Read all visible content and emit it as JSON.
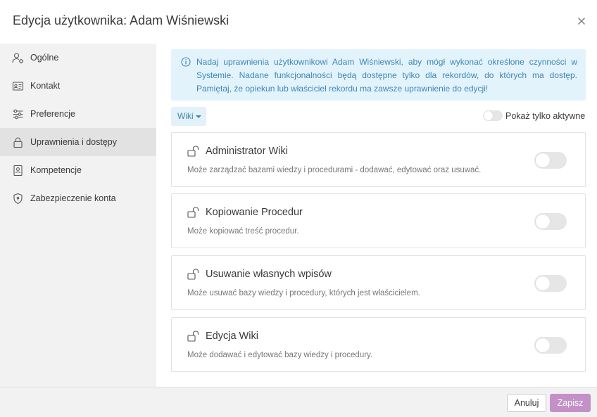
{
  "header": {
    "title": "Edycja użytkownika: Adam Wiśniewski",
    "close_icon": "close-icon"
  },
  "sidebar": {
    "items": [
      {
        "label": "Ogólne",
        "icon": "user-gear-icon",
        "active": false
      },
      {
        "label": "Kontakt",
        "icon": "id-card-icon",
        "active": false
      },
      {
        "label": "Preferencje",
        "icon": "sliders-icon",
        "active": false
      },
      {
        "label": "Uprawnienia i dostępy",
        "icon": "lock-icon",
        "active": true
      },
      {
        "label": "Kompetencje",
        "icon": "badge-icon",
        "active": false
      },
      {
        "label": "Zabezpieczenie konta",
        "icon": "shield-icon",
        "active": false
      }
    ]
  },
  "info": {
    "icon": "info-icon",
    "text": "Nadaj uprawnienia użytkownikowi Adam Wiśniewski, aby mógł wykonać określone czynności w Systemie. Nadane funkcjonalności będą dostępne tylko dla rekordów, do których ma dostęp. Pamiętaj, że opiekun lub właściciel rekordu ma zawsze uprawnienie do edycji!"
  },
  "filter": {
    "selected": "Wiki",
    "icon": "caret-down-icon"
  },
  "active_only": {
    "label": "Pokaż tylko aktywne",
    "enabled": false
  },
  "permissions": [
    {
      "title": "Administrator Wiki",
      "description": "Może zarządzać bazami wiedzy i procedurami - dodawać, edytować oraz usuwać.",
      "icon": "unlock-icon",
      "enabled": false
    },
    {
      "title": "Kopiowanie Procedur",
      "description": "Może kopiować treść procedur.",
      "icon": "unlock-icon",
      "enabled": false
    },
    {
      "title": "Usuwanie własnych wpisów",
      "description": "Może usuwać bazy wiedzy i procedury, których jest właścicielem.",
      "icon": "unlock-icon",
      "enabled": false
    },
    {
      "title": "Edycja Wiki",
      "description": "Może dodawać i edytować bazy wiedzy i procedury.",
      "icon": "unlock-icon",
      "enabled": false
    }
  ],
  "footer": {
    "cancel_label": "Anuluj",
    "save_label": "Zapisz"
  },
  "colors": {
    "accent": "#3e86b5",
    "info_bg": "#e3f3fc",
    "save_button": "#c490c8",
    "sidebar_bg": "#f2f2f2",
    "sidebar_active": "#e2e2e2"
  }
}
